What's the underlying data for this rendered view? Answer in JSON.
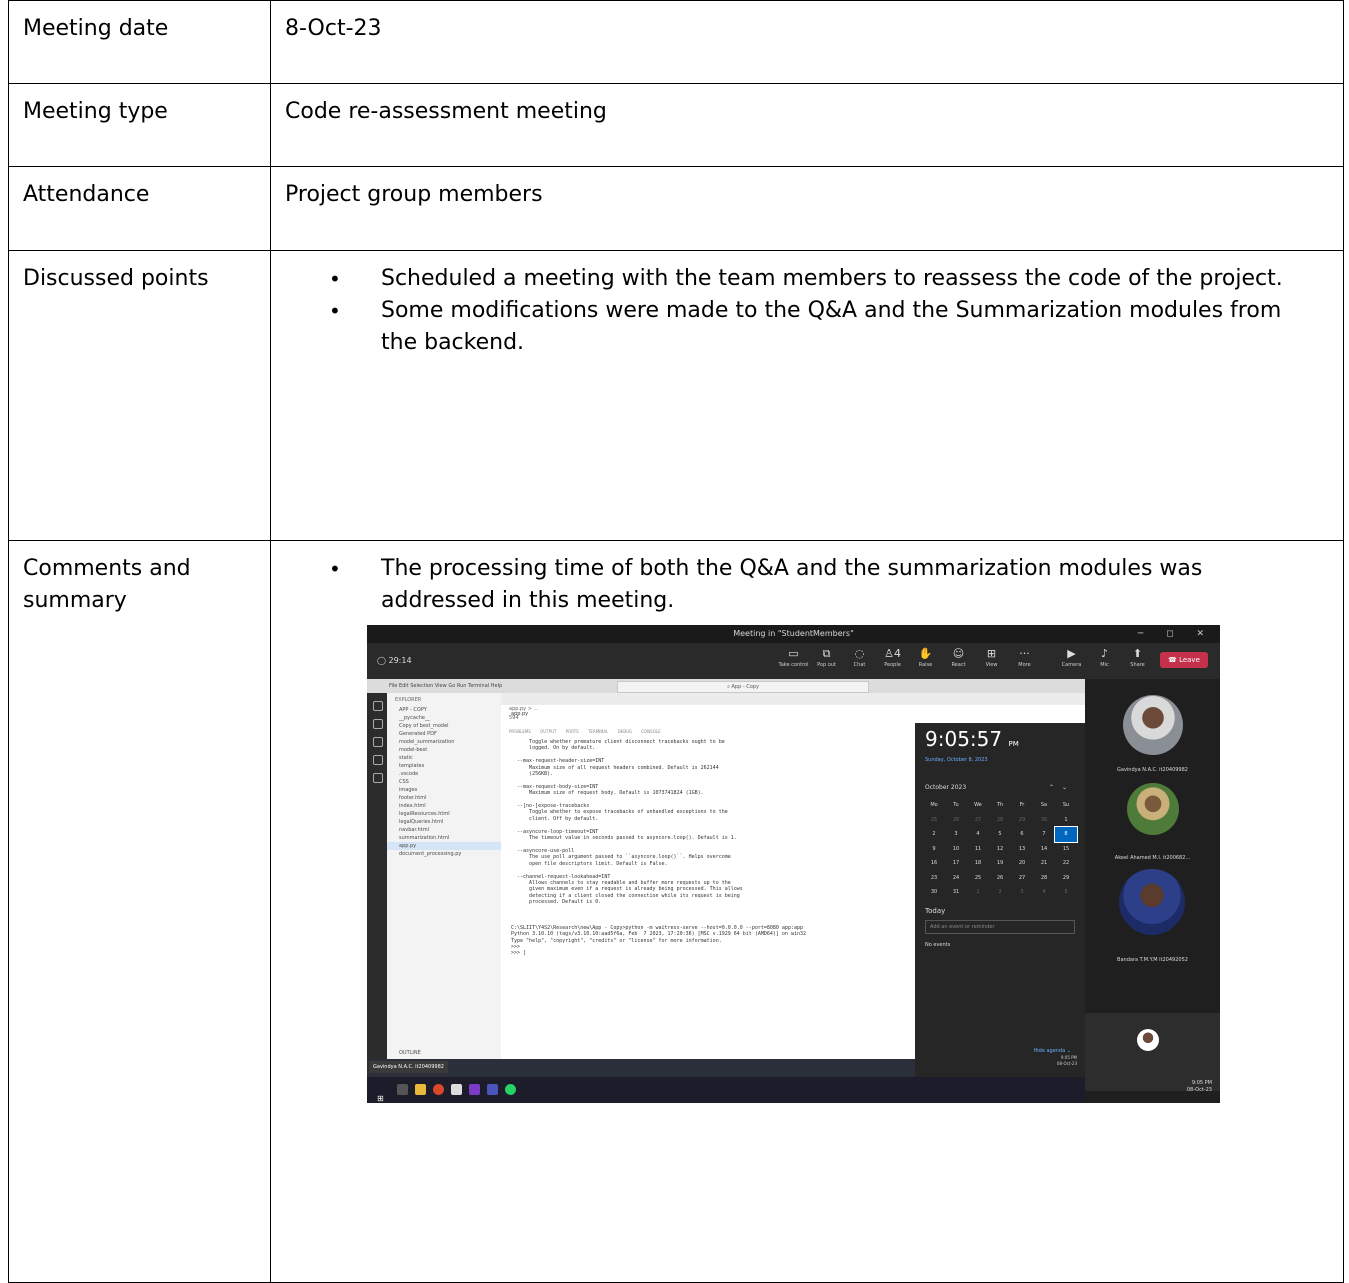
{
  "rows": {
    "meeting_date": {
      "label": "Meeting date",
      "value": "8-Oct-23"
    },
    "meeting_type": {
      "label": "Meeting type",
      "value": "Code re-assessment meeting"
    },
    "attendance": {
      "label": "Attendance",
      "value": "Project group members"
    },
    "discussed": {
      "label": "Discussed points",
      "items": [
        "Scheduled a meeting with the team members to reassess the code of the project.",
        "Some modifications were made to the Q&A and the Summarization modules from the backend."
      ]
    },
    "comments": {
      "label": "Comments and summary",
      "items": [
        "The processing time of both the Q&A and the summarization modules was addressed in this meeting."
      ]
    }
  },
  "screenshot": {
    "window_title": "Meeting in \"StudentMembers\"",
    "timer": "29:14",
    "toolbar": [
      "Take control",
      "Pop out",
      "Chat",
      "People",
      "Raise",
      "React",
      "View",
      "More",
      "Camera",
      "Mic",
      "Share"
    ],
    "people_count": "4",
    "leave_label": "Leave",
    "vscode": {
      "menu": "File  Edit  Selection  View  Go  Run  Terminal  Help",
      "search": "App - Copy",
      "explorer_header": "EXPLORER",
      "explorer_items": [
        "APP - COPY",
        "__pycache__",
        "Copy of best_model",
        "Generated PDF",
        "model_summarization",
        "model-best",
        "static",
        "templates",
        ".vscode",
        "CSS",
        "images",
        "footer.html",
        "index.html",
        "legalResources.html",
        "legalQueries.html",
        "navbar.html",
        "summarization.html",
        "app.py",
        "document_processing.py"
      ],
      "outline": "OUTLINE",
      "tab": "app.py",
      "breadcrumb": "app.py > ...",
      "line_no": "594",
      "panel_tabs": "PROBLEMS  OUTPUT  PORTS  TERMINAL  DEBUG CONSOLE",
      "terminal": "      Toggle whether premature client disconnect tracebacks ought to be\n      logged. On by default.\n\n  --max-request-header-size=INT\n      Maximum size of all request headers combined. Default is 262144\n      (256KB).\n\n  --max-request-body-size=INT\n      Maximum size of request body. Default is 1073741824 (1GB).\n\n  --[no-]expose-tracebacks\n      Toggle whether to expose tracebacks of unhandled exceptions to the\n      client. Off by default.\n\n  --asyncore-loop-timeout=INT\n      The timeout value in seconds passed to asyncore.loop(). Default is 1.\n\n  --asyncore-use-poll\n      The use_poll argument passed to ``asyncore.loop()``. Helps overcome\n      open file descriptors limit. Default is False.\n\n  --channel-request-lookahead=INT\n      Allows channels to stay readable and buffer more requests up to the\n      given maximum even if a request is already being processed. This allows\n      detecting if a client closed the connection while its request is being\n      processed. Default is 0.\n\n\n\nC:\\SLIIT\\Y4S2\\Research\\new\\App - Copy>python -m waitress-serve --host=0.0.0.0 --port=8080 app:app\nPython 3.10.10 (tags/v3.10.10:aad5f6a, Feb  7 2023, 17:20:36) [MSC v.1929 64 bit (AMD64)] on win32\nType \"help\", \"copyright\", \"credits\" or \"license\" for more information.\n>>>\n>>> [",
      "name_tag": "Gavindya N.A.C. it20409982"
    },
    "calendar": {
      "clock": "9:05:57",
      "ampm": "PM",
      "date_line": "Sunday, October 8, 2023",
      "month": "October 2023",
      "weekdays": [
        "Mo",
        "Tu",
        "We",
        "Th",
        "Fr",
        "Sa",
        "Su"
      ],
      "today_label": "Today",
      "add_placeholder": "Add an event or reminder",
      "no_events": "No events",
      "hide_agenda": "Hide agenda",
      "sys_time": "9:05 PM",
      "sys_date": "08-Oct-23"
    },
    "participants": [
      {
        "name": "Gavindya N.A.C. it20409982"
      },
      {
        "name": "Akeel Ahamed M.I. it200682..."
      },
      {
        "name": "Bandara T.M.Y.M it20492052"
      }
    ],
    "taskbar_time": "9:05 PM",
    "taskbar_date": "08-Oct-23"
  }
}
